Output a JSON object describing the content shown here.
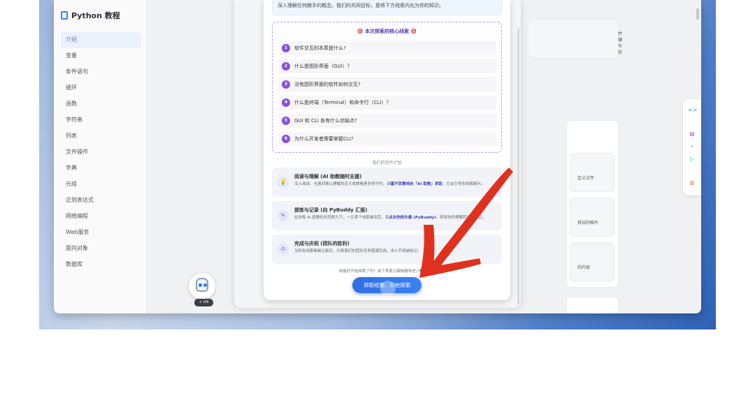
{
  "sidebar": {
    "brand": "Python 教程",
    "items": [
      {
        "label": "介绍",
        "active": true
      },
      {
        "label": "变量"
      },
      {
        "label": "条件语句"
      },
      {
        "label": "循环"
      },
      {
        "label": "函数"
      },
      {
        "label": "字符串"
      },
      {
        "label": "列表"
      },
      {
        "label": "文件操作"
      },
      {
        "label": "字典"
      },
      {
        "label": "元组"
      },
      {
        "label": "正则表达式"
      },
      {
        "label": "网络编程"
      },
      {
        "label": "Web服务"
      },
      {
        "label": "面向对象"
      },
      {
        "label": "数据库"
      }
    ]
  },
  "avatar": {
    "badge": "+ UN"
  },
  "background_snippets": {
    "top_right": "并编写你",
    "card1": "定义文件",
    "card2": "赏玩的图片",
    "card3": "的内容"
  },
  "modal": {
    "intro": "深入理解任何棘手的概念。我们的共同目标，是将下方线索内化为你的知识。",
    "clues_title": "🎯 本次探索的核心线索 🎯",
    "clues": [
      {
        "num": "1",
        "text": "软件交互的本质是什么?"
      },
      {
        "num": "2",
        "text": "什么是图形界面（GUI）？"
      },
      {
        "num": "3",
        "text": "没有图形界面的软件如何交互?"
      },
      {
        "num": "4",
        "text": "什么是终端（Terminal）和命令行（CLI）？"
      },
      {
        "num": "5",
        "text": "GUI 和 CLI 各有什么优缺点?"
      },
      {
        "num": "6",
        "text": "为什么开发者需要掌握CLI?"
      }
    ],
    "plan_label": "我们的协作计划",
    "steps": [
      {
        "icon": "💡",
        "title": "阅读与理解 (AI 助教随时支援)",
        "desc_pre": "深入阅读。当遇到难以理解的定义或想看更多例子时，请",
        "desc_bold": "毫不犹豫地向「AI 助教」求助",
        "desc_post": "，它会引导你拆解疑问。"
      },
      {
        "icon": "✎",
        "title": "提炼与记录 (向 PyBuddy 汇报)",
        "desc_pre": "在你和 AI 助教的共同努力下，一旦某个线索被攻克，就",
        "desc_bold": "点击你的头像 (PyBuddy)",
        "desc_post": "，即将你的理解转化为笔记。"
      },
      {
        "icon": "⊙",
        "title": "完成与庆祝 (团队的胜利)",
        "desc_pre": "当所有线索都被记录后，代表我们的团队任务圆满完成。",
        "desc_bold": "",
        "desc_post": "本小节将被标记。"
      }
    ],
    "footer_pre": "准备好开始探索了吗？接下来笔记编辑器将进入",
    "footer_bold": "待命状态",
    "cta": "领取线索，开始探索"
  },
  "colors": {
    "accent": "#3b82f6",
    "clue_number": "#8a4fe0",
    "arrow": "#e0301e"
  },
  "icons": [
    "book-icon",
    "code-icon",
    "note-icon",
    "chevron-left-icon",
    "play-icon",
    "robot-icon",
    "lightbulb-icon",
    "edit-icon",
    "check-circle-icon"
  ]
}
